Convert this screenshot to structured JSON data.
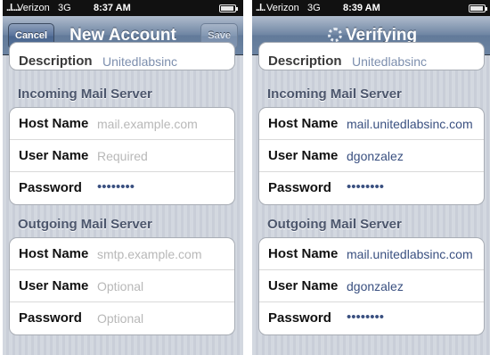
{
  "left": {
    "status": {
      "signal": "..l....",
      "carrier": "Verizon",
      "network": "3G",
      "time": "8:37 AM"
    },
    "nav": {
      "cancel": "Cancel",
      "title": "New Account",
      "save": "Save"
    },
    "description": {
      "label": "Description",
      "value": "Unitedlabsinc"
    },
    "incoming": {
      "title": "Incoming Mail Server",
      "host_label": "Host Name",
      "host_value": "mail.example.com",
      "user_label": "User Name",
      "user_value": "Required",
      "pass_label": "Password",
      "pass_value": "••••••••"
    },
    "outgoing": {
      "title": "Outgoing Mail Server",
      "host_label": "Host Name",
      "host_value": "smtp.example.com",
      "user_label": "User Name",
      "user_value": "Optional",
      "pass_label": "Password",
      "pass_value": "Optional"
    }
  },
  "right": {
    "status": {
      "signal": "..l..",
      "carrier": "Verizon",
      "network": "3G",
      "time": "8:39 AM"
    },
    "nav": {
      "title": "Verifying"
    },
    "description": {
      "label": "Description",
      "value": "Unitedlabsinc"
    },
    "incoming": {
      "title": "Incoming Mail Server",
      "host_label": "Host Name",
      "host_value": "mail.unitedlabsinc.com",
      "user_label": "User Name",
      "user_value": "dgonzalez",
      "pass_label": "Password",
      "pass_value": "••••••••"
    },
    "outgoing": {
      "title": "Outgoing Mail Server",
      "host_label": "Host Name",
      "host_value": "mail.unitedlabsinc.com",
      "user_label": "User Name",
      "user_value": "dgonzalez",
      "pass_label": "Password",
      "pass_value": "••••••••"
    }
  },
  "colors": {
    "nav_blue": "#6d84a2",
    "value_blue": "#3a5080",
    "placeholder_gray": "#b8b8b8",
    "section_text": "#4c566c"
  }
}
